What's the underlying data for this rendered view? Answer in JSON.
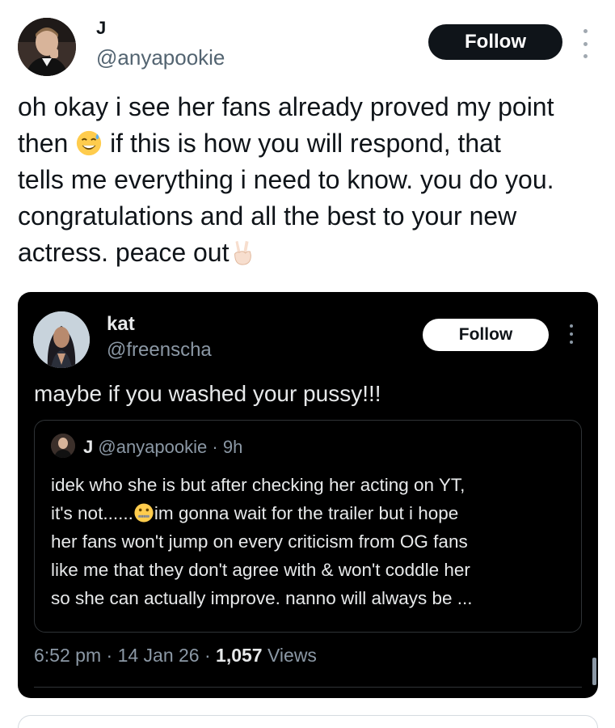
{
  "outer_tweet": {
    "author_name": "J",
    "author_handle": "@anyapookie",
    "follow_label": "Follow",
    "text_parts": [
      "oh okay i see her fans already proved my point\nthen ",
      " if this is how you will respond, that\ntells me everything i need to know. you do you.\ncongratulations and all the best to your new\nactress. peace out"
    ],
    "emojis": [
      "sweat-smile-emoji",
      "victory-hand-emoji"
    ]
  },
  "quoted_tweet": {
    "author_name": "kat",
    "author_handle": "@freenscha",
    "follow_label": "Follow",
    "text": "maybe if you washed your pussy!!!",
    "inner_quote": {
      "author_name": "J",
      "author_handle": "@anyapookie",
      "separator": "·",
      "time": "9h",
      "text_parts": [
        "idek who she is but after checking her acting on YT,\nit's not......",
        "im gonna wait for the trailer but i hope\nher fans won't jump on every criticism from OG fans\nlike me that they don't agree with & won't coddle her\nso she can actually improve. nanno will always be ..."
      ],
      "emoji": "zipper-mouth-emoji"
    },
    "meta": {
      "time": "6:52 pm",
      "date": "14 Jan 26",
      "separator": "·",
      "views_count": "1,057",
      "views_label": "Views"
    }
  },
  "colors": {
    "follow_dark_bg": "#0f1419",
    "quote_bg": "#000000",
    "secondary_text": "#536471",
    "dark_secondary_text": "#8b98a5"
  }
}
